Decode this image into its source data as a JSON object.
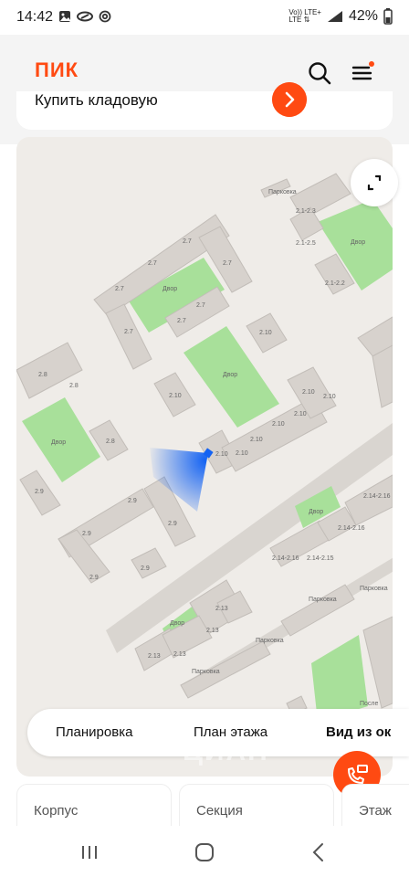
{
  "status_bar": {
    "time": "14:42",
    "network": "Vo)) LTE+\nLTE ⇅",
    "battery": "42%",
    "icons": [
      "image-icon",
      "infinity-icon",
      "at-icon",
      "signal-icon",
      "battery-icon"
    ]
  },
  "header": {
    "logo": "ПИК",
    "search_icon": "search-icon",
    "menu_icon": "menu-icon",
    "accent_color": "#ff4a12"
  },
  "store_card": {
    "label": "Купить кладовую",
    "arrow_icon": "arrow-right-icon"
  },
  "map": {
    "fullscreen_icon": "fullscreen-icon",
    "building_labels": [
      "2.7",
      "2.7",
      "2.7",
      "2.7",
      "2.7",
      "2.7",
      "2.8",
      "2.8",
      "2.8",
      "2.8",
      "2.9",
      "2.9",
      "2.9",
      "2.9",
      "2.9",
      "2.9",
      "2.10",
      "2.10",
      "2.10",
      "2.10",
      "2.10",
      "2.10",
      "2.10",
      "2.1-2.3",
      "2.1-2.5",
      "2.1-2.2",
      "2.13",
      "2.13",
      "2.13",
      "2.13",
      "2.14-2.16",
      "2.14-2.15",
      "2.14-2.16",
      "2.14-2.16",
      "Двор",
      "Двор",
      "Двор",
      "Двор",
      "Двор",
      "Двор",
      "Парковка",
      "Парковка",
      "Парковка",
      "Парковка",
      "После",
      "2.10",
      "2.10"
    ]
  },
  "view_tabs": [
    {
      "label": "Планировка",
      "active": false
    },
    {
      "label": "План этажа",
      "active": false
    },
    {
      "label": "Вид из ок",
      "active": true
    }
  ],
  "watermark": "ЦИАН",
  "call_button_icon": "phone-transfer-icon",
  "info_cards": [
    {
      "label": "Корпус"
    },
    {
      "label": "Секция"
    },
    {
      "label": "Этаж"
    }
  ],
  "nav_bar": {
    "icons": [
      "recent-apps-icon",
      "home-icon",
      "back-icon"
    ]
  }
}
